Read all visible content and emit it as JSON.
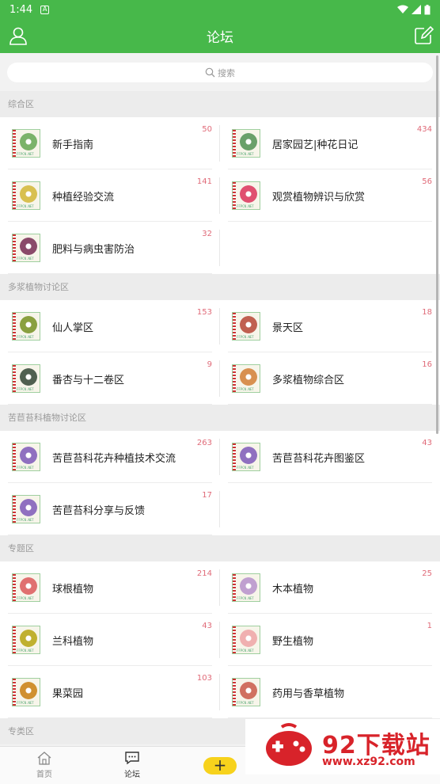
{
  "status": {
    "time": "1:44",
    "notif_glyph": "A"
  },
  "header": {
    "title": "论坛"
  },
  "search": {
    "placeholder": "搜索"
  },
  "sections": [
    {
      "title": "综合区",
      "items": [
        {
          "name": "新手指南",
          "count": "50",
          "color": "#7bb36a"
        },
        {
          "name": "居家园艺|种花日记",
          "count": "434",
          "color": "#6aa06a"
        },
        {
          "name": "种植经验交流",
          "count": "141",
          "color": "#d8c050"
        },
        {
          "name": "观赏植物辨识与欣赏",
          "count": "56",
          "color": "#e05070"
        },
        {
          "name": "肥料与病虫害防治",
          "count": "32",
          "color": "#8a4a6a"
        }
      ]
    },
    {
      "title": "多浆植物讨论区",
      "items": [
        {
          "name": "仙人掌区",
          "count": "153",
          "color": "#8aa040"
        },
        {
          "name": "景天区",
          "count": "18",
          "color": "#c06050"
        },
        {
          "name": "番杏与十二卷区",
          "count": "9",
          "color": "#506050"
        },
        {
          "name": "多浆植物综合区",
          "count": "16",
          "color": "#d89050"
        }
      ]
    },
    {
      "title": "苦苣苔科植物讨论区",
      "items": [
        {
          "name": "苦苣苔科花卉种植技术交流",
          "count": "263",
          "color": "#9070c0"
        },
        {
          "name": "苦苣苔科花卉图鉴区",
          "count": "43",
          "color": "#9070c0"
        },
        {
          "name": "苦苣苔科分享与反馈",
          "count": "17",
          "color": "#9070c0"
        }
      ]
    },
    {
      "title": "专题区",
      "items": [
        {
          "name": "球根植物",
          "count": "214",
          "color": "#e07070"
        },
        {
          "name": "木本植物",
          "count": "25",
          "color": "#c0a0d0"
        },
        {
          "name": "兰科植物",
          "count": "43",
          "color": "#c0b030"
        },
        {
          "name": "野生植物",
          "count": "1",
          "color": "#f0b0b0"
        },
        {
          "name": "果菜园",
          "count": "103",
          "color": "#d09030"
        },
        {
          "name": "药用与香草植物",
          "count": "",
          "color": "#d07060"
        }
      ]
    },
    {
      "title": "专类区",
      "items": []
    }
  ],
  "nav": {
    "home": "首页",
    "forum": "论坛",
    "plus": "+"
  },
  "watermark": {
    "title": "92下载站",
    "url": "www.xz92.com"
  },
  "colors": {
    "primary": "#47b84a",
    "count": "#e06a78",
    "accent": "#f7d21c",
    "watermark": "#d8232a"
  }
}
